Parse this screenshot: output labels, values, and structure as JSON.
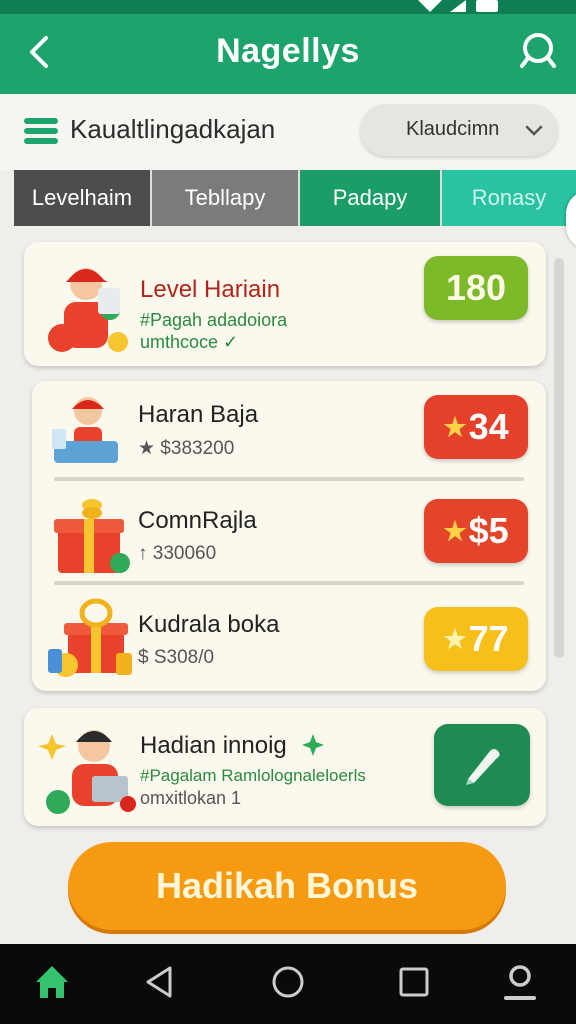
{
  "app": {
    "title": "Nagellys"
  },
  "filter": {
    "label": "Kaualtlingadkajan",
    "dropdown_value": "Klaudcimn"
  },
  "tabs": [
    {
      "label": "Levelhaim"
    },
    {
      "label": "Tebllapy"
    },
    {
      "label": "Padapy"
    },
    {
      "label": "Ronasy"
    }
  ],
  "rewards": [
    {
      "title": "Level Hariain",
      "subtitle": "#Pagah adadoiora",
      "subtitle2": "umthcoce ✓",
      "badge": "180",
      "badge_color": "#7cba2a"
    },
    {
      "title": "Haran Baja",
      "subtitle": "★ $383200",
      "badge": "34",
      "badge_color": "#e4402a"
    },
    {
      "title": "ComnRajla",
      "subtitle": "↑ 330060",
      "badge": "$5",
      "badge_color": "#e4452a"
    },
    {
      "title": "Kudrala boka",
      "subtitle": "$ S308/0",
      "badge": "77",
      "badge_color": "#f6bf19"
    },
    {
      "title": "Hadian innoig",
      "subtitle": "#Pagalam Ramlolognaleloerls",
      "subtitle2": "omxitlokan 1"
    }
  ],
  "cta": {
    "label": "Hadikah Bonus"
  },
  "icons": [
    "back-arrow-icon",
    "search-icon",
    "menu-icon",
    "chevron-down-icon",
    "star-icon",
    "pencil-icon",
    "home-icon",
    "back-triangle-icon",
    "home-circle-icon",
    "recents-square-icon",
    "profile-icon"
  ],
  "colors": {
    "primary": "#1da46c",
    "accent": "#f69a12"
  }
}
